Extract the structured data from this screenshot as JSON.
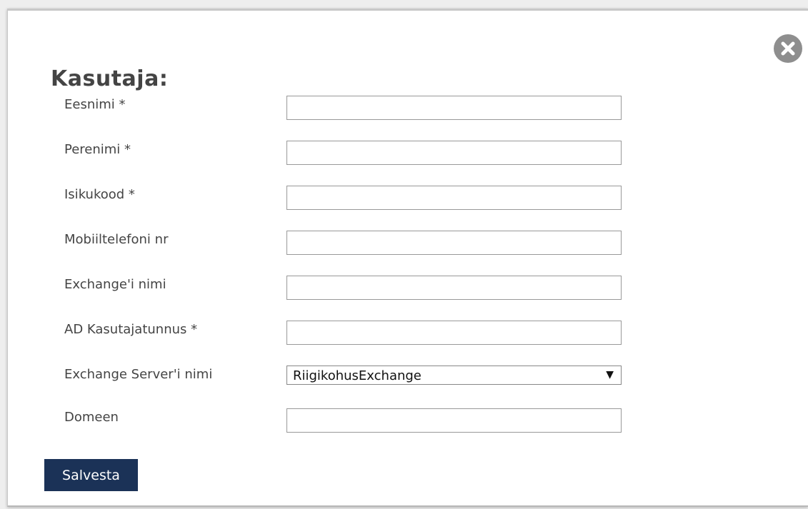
{
  "dialog": {
    "title": "Kasutaja:",
    "close_icon": "close-circle-icon"
  },
  "fields": [
    {
      "label": "Eesnimi *",
      "value": "",
      "type": "text"
    },
    {
      "label": "Perenimi *",
      "value": "",
      "type": "text"
    },
    {
      "label": "Isikukood *",
      "value": "",
      "type": "text"
    },
    {
      "label": "Mobiiltelefoni nr",
      "value": "",
      "type": "text"
    },
    {
      "label": "Exchange'i nimi",
      "value": "",
      "type": "text"
    },
    {
      "label": "AD Kasutajatunnus *",
      "value": "",
      "type": "text"
    },
    {
      "label": "Exchange Server'i nimi",
      "value": "RiigikohusExchange",
      "type": "select"
    },
    {
      "label": "Domeen",
      "value": "",
      "type": "text"
    }
  ],
  "actions": {
    "save_label": "Salvesta"
  },
  "colors": {
    "save_button_bg": "#1b3257",
    "close_button_bg": "#8e8e8e"
  }
}
